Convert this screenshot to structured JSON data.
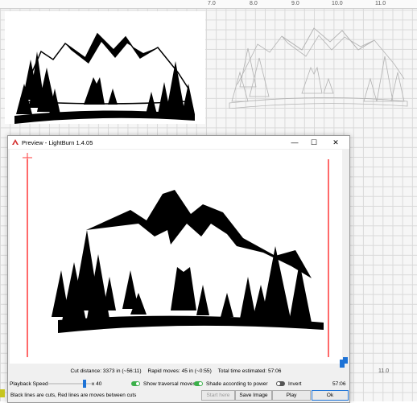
{
  "workspace": {
    "ruler_labels": [
      "7.0",
      "8.0",
      "9.0",
      "10.0",
      "11.0"
    ],
    "side_label": "11.0"
  },
  "window": {
    "title": "Preview - LightBurn 1.4.05",
    "minimize_symbol": "—",
    "maximize_symbol": "☐",
    "close_symbol": "✕"
  },
  "stats": {
    "cut_distance": "Cut distance: 3373 in (~56:11)",
    "rapid_moves": "Rapid moves: 45 in (~0:55)",
    "total_time": "Total time estimated: 57:06"
  },
  "controls": {
    "playback_speed_label": "Playback Speed",
    "playback_speed_fraction": 0.8,
    "multiplier": "x 40",
    "show_traversal_label": "Show traversal moves",
    "show_traversal_on": true,
    "shade_power_label": "Shade according to power",
    "shade_power_on": true,
    "invert_label": "Invert",
    "invert_on": false,
    "elapsed_time": "57:06"
  },
  "legend_text": "Black lines are cuts, Red lines are moves between cuts",
  "buttons": {
    "start_here": "Start here",
    "save_image": "Save Image",
    "play": "Play",
    "ok": "Ok"
  },
  "colors": {
    "accent": "#1e73d6",
    "toggle_on": "#3bb04a",
    "traversal_red": "#ff5a5a"
  }
}
